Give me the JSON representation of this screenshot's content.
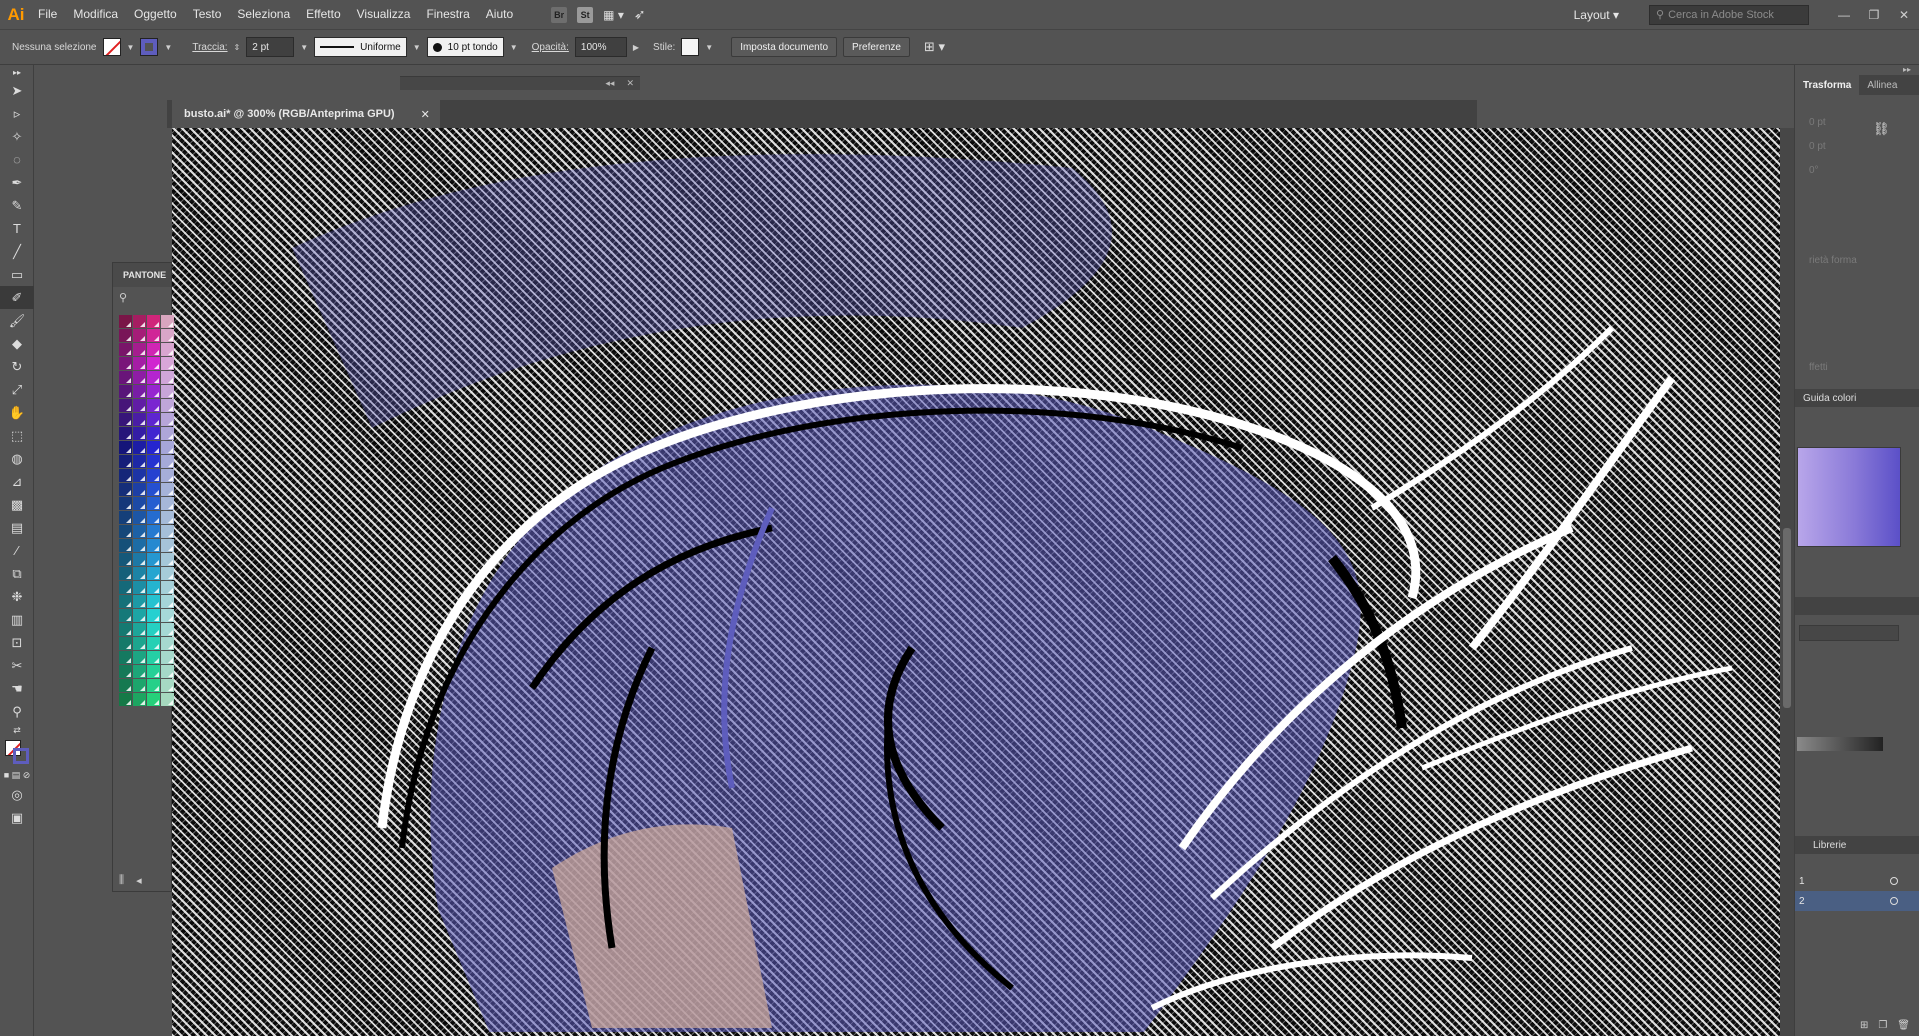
{
  "app": {
    "logo": "Ai"
  },
  "menu": [
    "File",
    "Modifica",
    "Oggetto",
    "Testo",
    "Seleziona",
    "Effetto",
    "Visualizza",
    "Finestra",
    "Aiuto"
  ],
  "menubar_icons": {
    "bridge": "Br",
    "stock": "St"
  },
  "layout_label": "Layout",
  "stock_search_placeholder": "Cerca in Adobe Stock",
  "control": {
    "selection": "Nessuna selezione",
    "stroke_label": "Traccia:",
    "stroke_value": "2 pt",
    "profile": "Uniforme",
    "brush": "10 pt tondo",
    "opacity_label": "Opacità:",
    "opacity_value": "100%",
    "style_label": "Stile:",
    "doc_setup": "Imposta documento",
    "prefs": "Preferenze"
  },
  "doc_tab": {
    "title": "busto.ai* @ 300% (RGB/Anteprima GPU)"
  },
  "pantone_panel": {
    "title": "PANTONE"
  },
  "right_panel": {
    "tabs": [
      "Trasforma",
      "Allinea"
    ],
    "ghost_fields": [
      "0 pt",
      "0 pt",
      "0°",
      "rietà forma",
      "ffetti"
    ],
    "guide_tab": "Guida colori",
    "library_tab": "Librerie",
    "layers": [
      "1",
      "2"
    ]
  },
  "colors": {
    "accent_purple": "#5e5dbd",
    "ai_orange": "#ff9a00"
  }
}
